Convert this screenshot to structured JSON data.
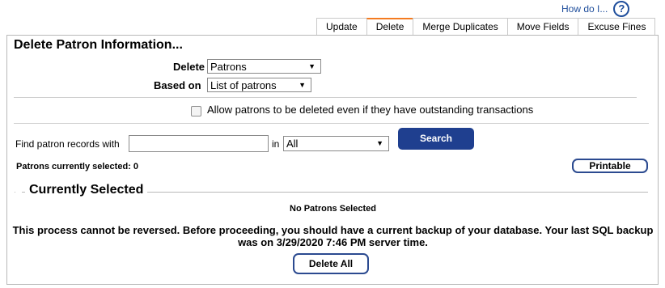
{
  "help": {
    "label": "How do I...",
    "icon": "question-circle-icon"
  },
  "tabs": [
    {
      "label": "Update",
      "active": false
    },
    {
      "label": "Delete",
      "active": true
    },
    {
      "label": "Merge Duplicates",
      "active": false
    },
    {
      "label": "Move Fields",
      "active": false
    },
    {
      "label": "Excuse Fines",
      "active": false
    }
  ],
  "form": {
    "title": "Delete Patron Information...",
    "delete_label": "Delete",
    "delete_value": "Patrons",
    "based_on_label": "Based on",
    "based_on_value": "List of patrons",
    "checkbox_label": "Allow patrons to be deleted even if they have outstanding transactions",
    "checkbox_checked": false,
    "find_label": "Find patron records with",
    "find_value": "",
    "in_label": "in",
    "in_value": "All",
    "search_label": "Search",
    "selected_count_text": "Patrons currently selected: 0",
    "printable_label": "Printable"
  },
  "selected": {
    "legend": "Currently Selected",
    "empty_text": "No Patrons Selected"
  },
  "warning": {
    "line1": "This process cannot be reversed. Before proceeding, you should have a current backup of your database. Your last SQL backup",
    "line2": "was on 3/29/2020 7:46 PM server time."
  },
  "delete_all_label": "Delete All",
  "colors": {
    "accent": "#f47b20",
    "button": "#1f3f8f",
    "link": "#1f4e9c"
  }
}
